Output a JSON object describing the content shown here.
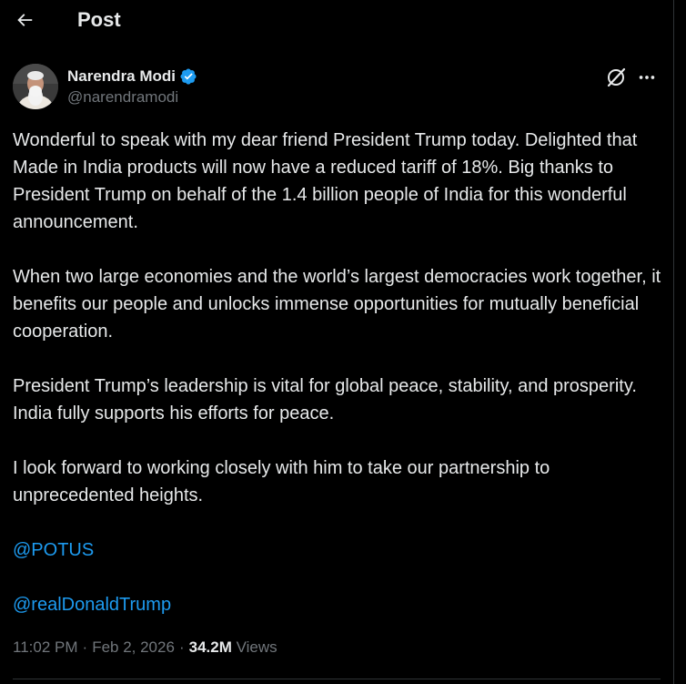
{
  "header": {
    "title": "Post"
  },
  "author": {
    "name": "Narendra Modi",
    "handle": "@narendramodi",
    "verified_color": "#1d9bf0"
  },
  "post": {
    "paragraphs": [
      "Wonderful to speak with my dear friend President Trump today. Delighted that Made in India products will now have a reduced tariff of 18%. Big thanks to President Trump on behalf of the 1.4 billion people of India for this wonderful announcement.",
      "When two large economies and the world’s largest democracies work together, it benefits our people and unlocks immense opportunities for mutually beneficial cooperation.",
      "President Trump’s leadership is vital for global peace, stability, and prosperity. India fully supports his efforts for peace.",
      "I look forward to working closely with him to take our partnership to unprecedented heights."
    ],
    "mentions": [
      "@POTUS",
      "@realDonaldTrump"
    ]
  },
  "meta": {
    "time": "11:02 PM",
    "separator": "·",
    "date": "Feb 2, 2026",
    "views_count": "34.2M",
    "views_label": "Views"
  },
  "icons": {
    "back": "arrow-left-icon",
    "verified": "verified-badge-icon",
    "grok": "grok-icon",
    "more": "more-horizontal-icon"
  },
  "colors": {
    "background": "#000000",
    "text": "#e7e9ea",
    "secondary": "#71767b",
    "link": "#1d9bf0",
    "border": "#2f3336"
  }
}
